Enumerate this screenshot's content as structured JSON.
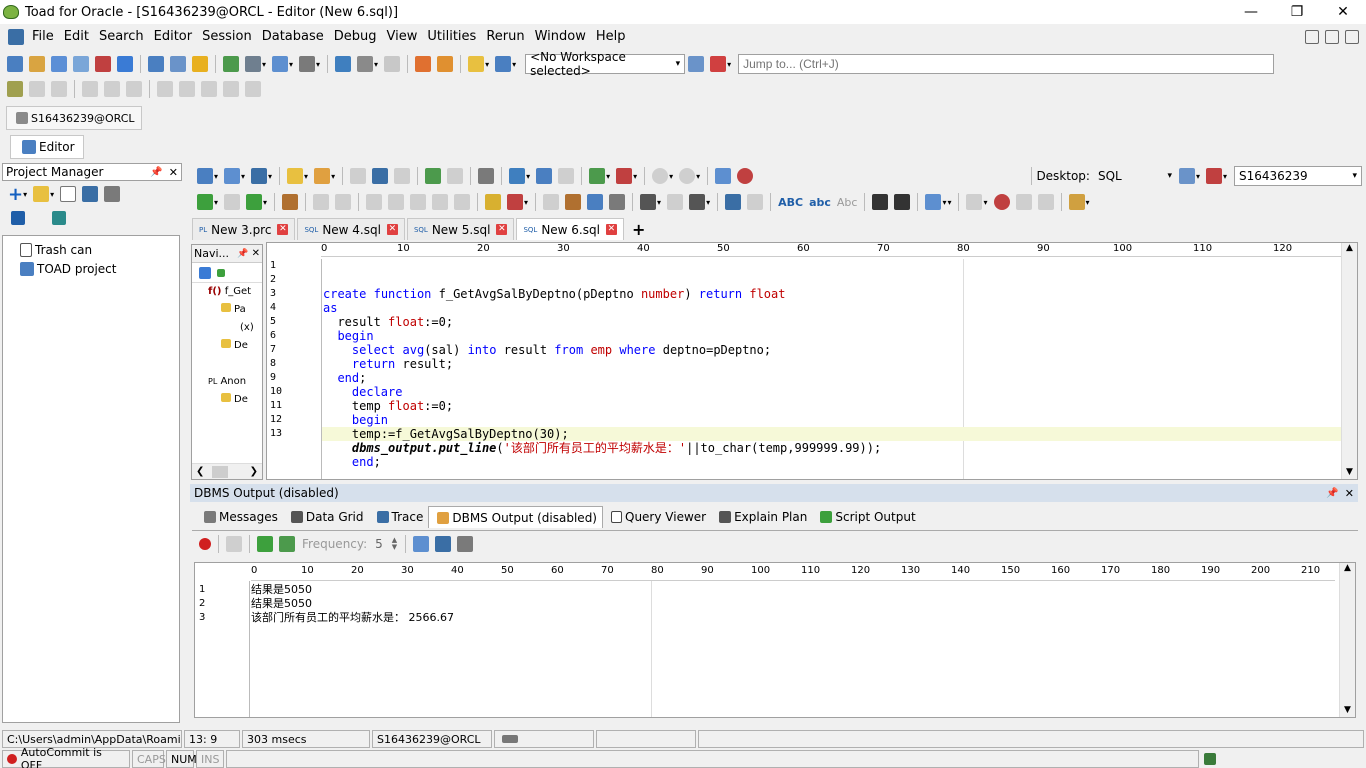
{
  "window": {
    "title": "Toad for Oracle - [S16436239@ORCL - Editor (New 6.sql)]"
  },
  "menu": [
    "File",
    "Edit",
    "Search",
    "Editor",
    "Session",
    "Database",
    "Debug",
    "View",
    "Utilities",
    "Rerun",
    "Window",
    "Help"
  ],
  "toolbar": {
    "workspace": "<No Workspace selected>",
    "jump_placeholder": "Jump to... (Ctrl+J)"
  },
  "connection_tab": "S16436239@ORCL",
  "editor_tab_label": "Editor",
  "project_manager": {
    "title": "Project Manager",
    "items": [
      "Trash can",
      "TOAD project"
    ]
  },
  "navigator": {
    "title": "Navi...",
    "items": [
      "f_Get",
      "Pa",
      "(x)",
      "De",
      "Anon",
      "De"
    ]
  },
  "editor_toolbar": {
    "desktop_label": "Desktop:",
    "desktop_value": "SQL",
    "schema_value": "S16436239"
  },
  "doc_tabs": [
    {
      "label": "New 3.prc",
      "active": false
    },
    {
      "label": "New 4.sql",
      "active": false
    },
    {
      "label": "New 5.sql",
      "active": false
    },
    {
      "label": "New 6.sql",
      "active": true
    }
  ],
  "ruler_top": [
    "0",
    "10",
    "20",
    "30",
    "40",
    "50",
    "60",
    "70",
    "80",
    "90",
    "100",
    "110",
    "120"
  ],
  "code_lines": [
    "create function f_GetAvgSalByDeptno(pDeptno number) return float",
    "as",
    "  result float:=0;",
    "  begin",
    "    select avg(sal) into result from emp where deptno=pDeptno;",
    "    return result;",
    "  end;",
    "    declare",
    "    temp float:=0;",
    "    begin",
    "    temp:=f_GetAvgSalByDeptno(30);",
    "    dbms_output.put_line('该部门所有员工的平均薪水是：'||to_char(temp,999999.99));",
    "    end;"
  ],
  "line_numbers": [
    "1",
    "2",
    "3",
    "4",
    "5",
    "6",
    "7",
    "8",
    "9",
    "10",
    "11",
    "12",
    "13"
  ],
  "output_panel": {
    "title": "DBMS Output (disabled)",
    "tabs": [
      "Messages",
      "Data Grid",
      "Trace",
      "DBMS Output (disabled)",
      "Query Viewer",
      "Explain Plan",
      "Script Output"
    ],
    "frequency_label": "Frequency:",
    "frequency_value": "5",
    "ruler": [
      "0",
      "10",
      "20",
      "30",
      "40",
      "50",
      "60",
      "70",
      "80",
      "90",
      "100",
      "110",
      "120",
      "130",
      "140",
      "150",
      "160",
      "170",
      "180",
      "190",
      "200",
      "210"
    ],
    "lines": [
      {
        "n": "1",
        "text": "结果是5050"
      },
      {
        "n": "2",
        "text": "结果是5050"
      },
      {
        "n": "3",
        "text": "该部门所有员工的平均薪水是：  2566.67"
      }
    ]
  },
  "status": {
    "path": "C:\\Users\\admin\\AppData\\Roaming\\Q",
    "position": "13:  9",
    "time": "303 msecs",
    "conn": "S16436239@ORCL",
    "autocommit": "AutoCommit is OFF",
    "caps": "CAPS",
    "num": "NUM",
    "ins": "INS"
  }
}
